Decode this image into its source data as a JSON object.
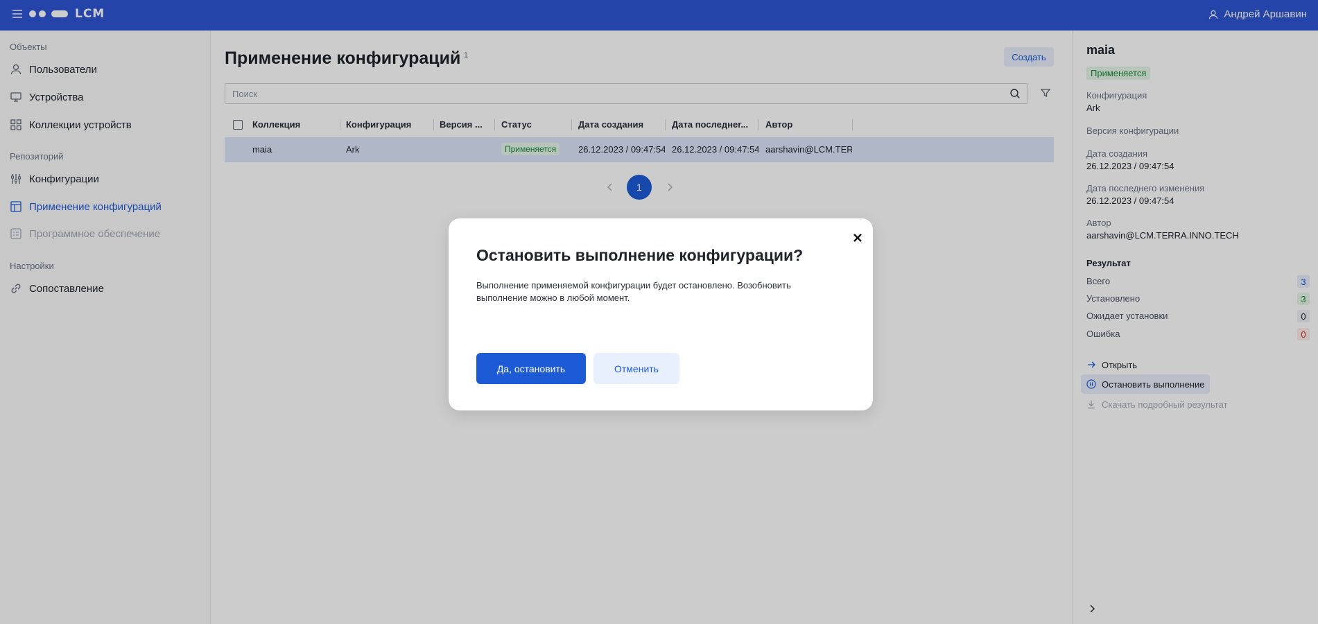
{
  "topbar": {
    "logo_text": "LCM",
    "user_name": "Андрей Аршавин"
  },
  "sidebar": {
    "sections": [
      {
        "title": "Объекты"
      },
      {
        "title": "Репозиторий"
      },
      {
        "title": "Настройки"
      }
    ],
    "items": [
      {
        "label": "Пользователи",
        "icon": "user-icon"
      },
      {
        "label": "Устройства",
        "icon": "monitor-icon"
      },
      {
        "label": "Коллекции устройств",
        "icon": "grid-icon"
      },
      {
        "label": "Конфигурации",
        "icon": "sliders-icon"
      },
      {
        "label": "Применение конфигураций",
        "icon": "layout-icon",
        "active": true
      },
      {
        "label": "Программное обеспечение",
        "icon": "software-icon",
        "disabled": true
      },
      {
        "label": "Сопоставление",
        "icon": "link-icon"
      }
    ]
  },
  "main": {
    "title": "Применение конфигураций",
    "title_count": "1",
    "create_label": "Создать",
    "search_placeholder": "Поиск",
    "columns": [
      "Коллекция",
      "Конфигурация",
      "Версия ...",
      "Статус",
      "Дата создания",
      "Дата последнег...",
      "Автор"
    ],
    "rows": [
      {
        "collection": "maia",
        "configuration": "Ark",
        "version": "",
        "status": "Применяется",
        "created": "26.12.2023 / 09:47:54",
        "modified": "26.12.2023 / 09:47:54",
        "author": "aarshavin@LCM.TERRA.INNO.TECH"
      }
    ],
    "pagination": {
      "current_page": "1"
    }
  },
  "details": {
    "title": "maia",
    "status": "Применяется",
    "config_label": "Конфигурация",
    "config_value": "Ark",
    "version_label": "Версия конфигурации",
    "created_label": "Дата создания",
    "created_value": "26.12.2023 / 09:47:54",
    "modified_label": "Дата последнего изменения",
    "modified_value": "26.12.2023 / 09:47:54",
    "author_label": "Автор",
    "author_value": "aarshavin@LCM.TERRA.INNO.TECH",
    "result_title": "Результат",
    "results": [
      {
        "label": "Всего",
        "count": "3",
        "color": "#1d5bd6",
        "bg": "#e8eefc"
      },
      {
        "label": "Установлено",
        "count": "3",
        "color": "#1a8a3c",
        "bg": "#e5f5e9"
      },
      {
        "label": "Ожидает установки",
        "count": "0",
        "color": "#1f2329",
        "bg": "#eef0f3"
      },
      {
        "label": "Ошибка",
        "count": "0",
        "color": "#d93025",
        "bg": "#fdecea"
      }
    ],
    "actions": {
      "open": "Открыть",
      "stop": "Остановить выполнение",
      "download": "Скачать подробный результат"
    }
  },
  "modal": {
    "title": "Остановить выполнение конфигурации?",
    "text": "Выполнение применяемой конфигурации будет остановлено. Возобновить выполнение можно в любой момент.",
    "confirm_label": "Да, остановить",
    "cancel_label": "Отменить"
  }
}
